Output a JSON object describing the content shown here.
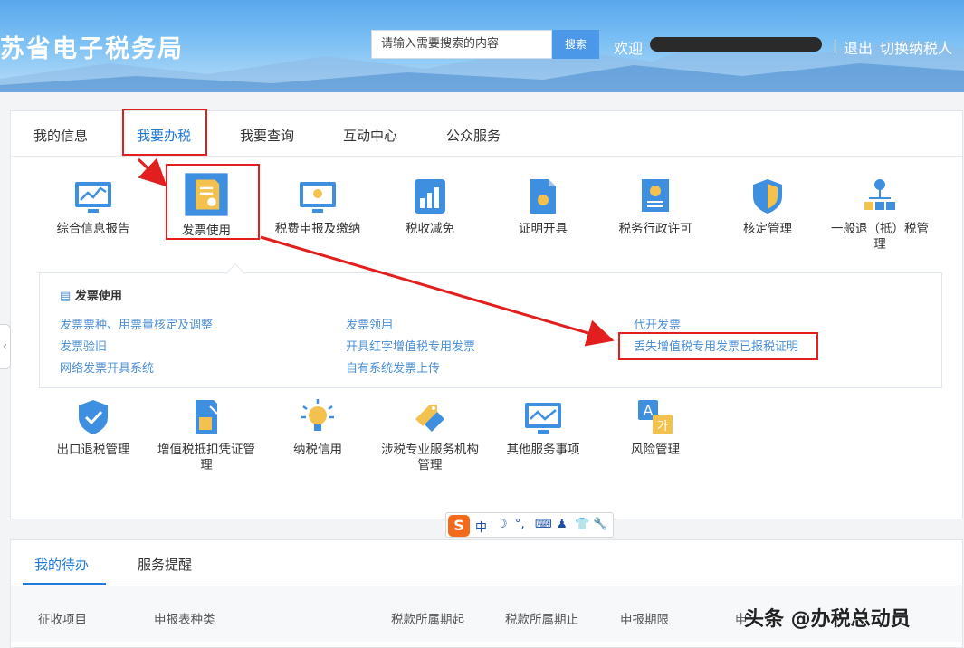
{
  "header": {
    "site_title": "苏省电子税务局",
    "search_placeholder": "请输入需要搜索的内容",
    "search_button": "搜索",
    "welcome": "欢迎",
    "separator": "|",
    "logout": "退出",
    "switch_taxpayer": "切换纳税人"
  },
  "tabs": [
    {
      "label": "我的信息"
    },
    {
      "label": "我要办税"
    },
    {
      "label": "我要查询"
    },
    {
      "label": "互动中心"
    },
    {
      "label": "公众服务"
    }
  ],
  "row1": [
    {
      "label": "综合信息报告",
      "icon": "chart-monitor-icon"
    },
    {
      "label": "发票使用",
      "icon": "invoice-document-icon"
    },
    {
      "label": "税费申报及缴纳",
      "icon": "monitor-icon"
    },
    {
      "label": "税收减免",
      "icon": "bar-chart-icon"
    },
    {
      "label": "证明开具",
      "icon": "certificate-file-icon"
    },
    {
      "label": "税务行政许可",
      "icon": "license-icon"
    },
    {
      "label": "核定管理",
      "icon": "shield-icon"
    },
    {
      "label": "一般退（抵）税管理",
      "icon": "org-chart-icon"
    }
  ],
  "submenu": {
    "title": "发票使用",
    "col1": [
      "发票票种、用票量核定及调整",
      "发票验旧",
      "网络发票开具系统"
    ],
    "col2": [
      "发票领用",
      "开具红字增值税专用发票",
      "自有系统发票上传"
    ],
    "col3": [
      "代开发票",
      "丢失增值税专用发票已报税证明"
    ]
  },
  "row2": [
    {
      "label": "出口退税管理",
      "icon": "shield-check-icon"
    },
    {
      "label": "增值税抵扣凭证管理",
      "icon": "document-pen-icon"
    },
    {
      "label": "纳税信用",
      "icon": "lightbulb-icon"
    },
    {
      "label": "涉税专业服务机构管理",
      "icon": "tag-icon"
    },
    {
      "label": "其他服务事项",
      "icon": "monitor-chart-icon"
    },
    {
      "label": "风险管理",
      "icon": "translate-icon"
    }
  ],
  "bottom": {
    "tabs": [
      "我的待办",
      "服务提醒"
    ],
    "columns": [
      "征收项目",
      "申报表种类",
      "税款所属期起",
      "税款所属期止",
      "申报期限",
      "申"
    ]
  },
  "ime": {
    "logo": "S",
    "items": [
      "中",
      "☽",
      "°,",
      "⌨",
      "♟",
      "👕",
      "🔧"
    ]
  },
  "watermark": "头条 @办税总动员",
  "colors": {
    "accent": "#1f79d6",
    "link": "#4c8fd3",
    "annotation": "#e11f1f"
  }
}
